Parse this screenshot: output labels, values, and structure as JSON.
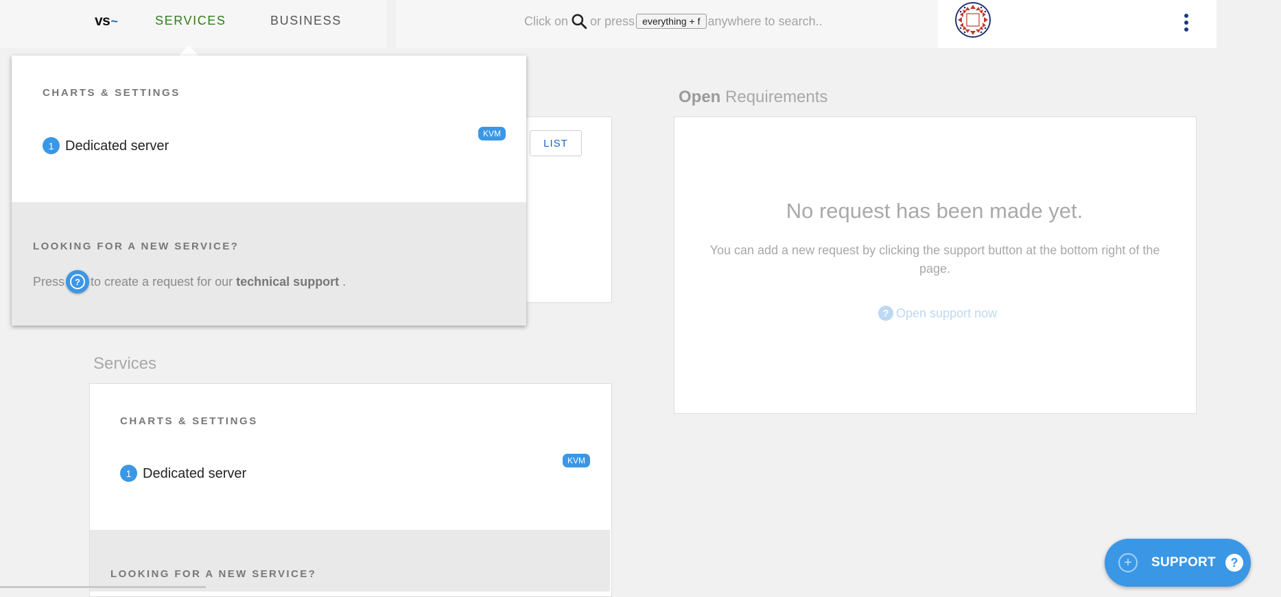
{
  "header": {
    "logo_text": "vs",
    "logo_tilde": "~",
    "nav": {
      "services_label": "SERVICES",
      "business_label": "BUSINESS"
    },
    "search": {
      "before": "Click on",
      "middle": "or press",
      "shortcut": "everything + f",
      "after": "anywhere to search.."
    }
  },
  "services_menu": {
    "section_heading": "CHARTS & SETTINGS",
    "item": {
      "count": "1",
      "name": "Dedicated server",
      "badge": "KVM"
    },
    "new_service_heading": "LOOKING FOR A NEW SERVICE?",
    "press_before": "Press",
    "press_after": "to create a request for our",
    "support_link": "technical support",
    "press_end": "."
  },
  "list_button_label": "LIST",
  "requirements": {
    "title_bold": "Open",
    "title_rest": "Requirements",
    "empty_title": "No request has been made yet.",
    "empty_desc": "You can add a new request by clicking the support button at the bottom right of the page.",
    "open_support_label": "Open support now"
  },
  "services_section": {
    "title": "Services",
    "section_heading": "CHARTS & SETTINGS",
    "item": {
      "count": "1",
      "name": "Dedicated server",
      "badge": "KVM"
    },
    "new_service_heading": "LOOKING FOR A NEW SERVICE?"
  },
  "support_fab": {
    "label": "SUPPORT"
  },
  "icons": [
    "search-icon",
    "question-icon",
    "plus-icon",
    "more-vert-icon",
    "avatar-pattern-icon"
  ],
  "colors": {
    "accent": "#3a97e6",
    "nav_active": "#2e7d1a",
    "link": "#1565c0"
  }
}
